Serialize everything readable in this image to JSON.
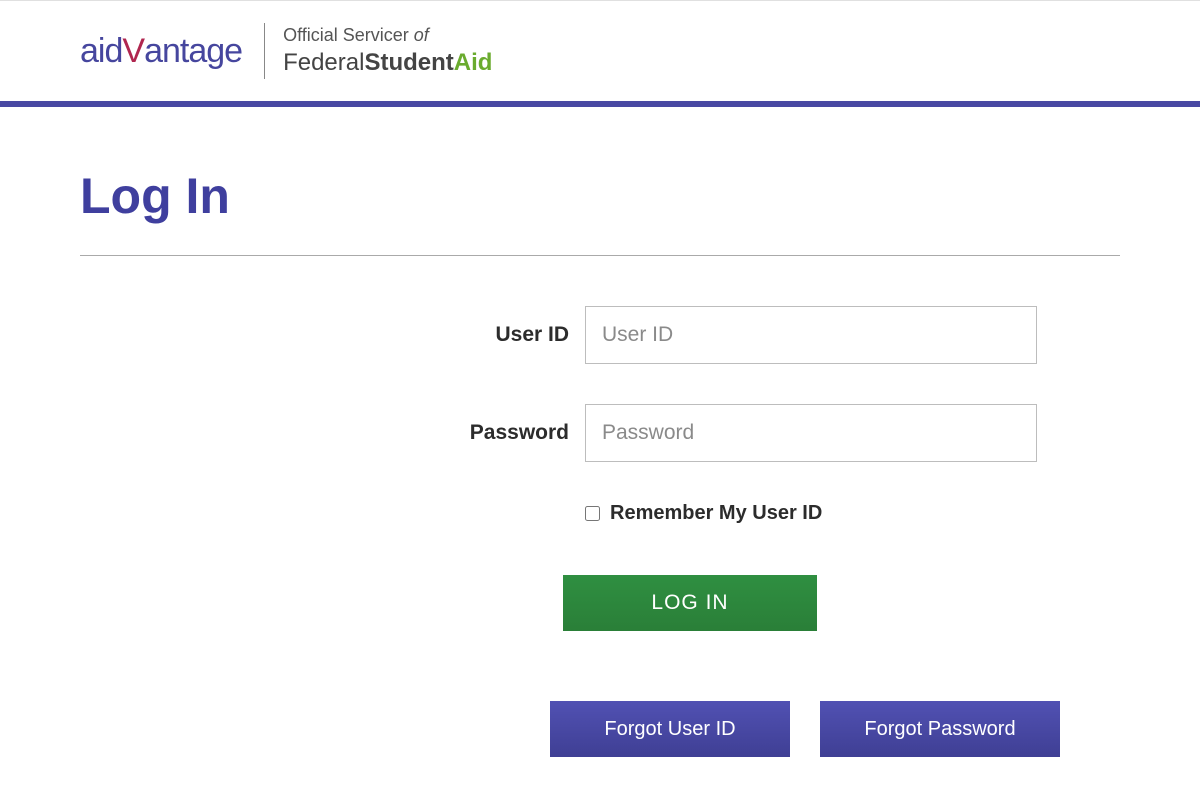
{
  "header": {
    "brand_aid": "aid",
    "brand_v": "V",
    "brand_antage": "antage",
    "tagline_top_prefix": "Official Servicer ",
    "tagline_top_of": "of",
    "tagline_federal": "Federal",
    "tagline_student": "Student",
    "tagline_aid": "Aid"
  },
  "page": {
    "title": "Log In"
  },
  "form": {
    "user_id_label": "User ID",
    "user_id_placeholder": "User ID",
    "user_id_value": "",
    "password_label": "Password",
    "password_placeholder": "Password",
    "password_value": "",
    "remember_label": "Remember My User ID",
    "login_button": "LOG IN",
    "forgot_user_id": "Forgot User ID",
    "forgot_password": "Forgot Password"
  },
  "colors": {
    "brand_purple": "#46469e",
    "brand_red": "#b0264f",
    "accent_green": "#6aab2e",
    "button_green": "#2d8a3e",
    "button_purple": "#4848a5"
  }
}
